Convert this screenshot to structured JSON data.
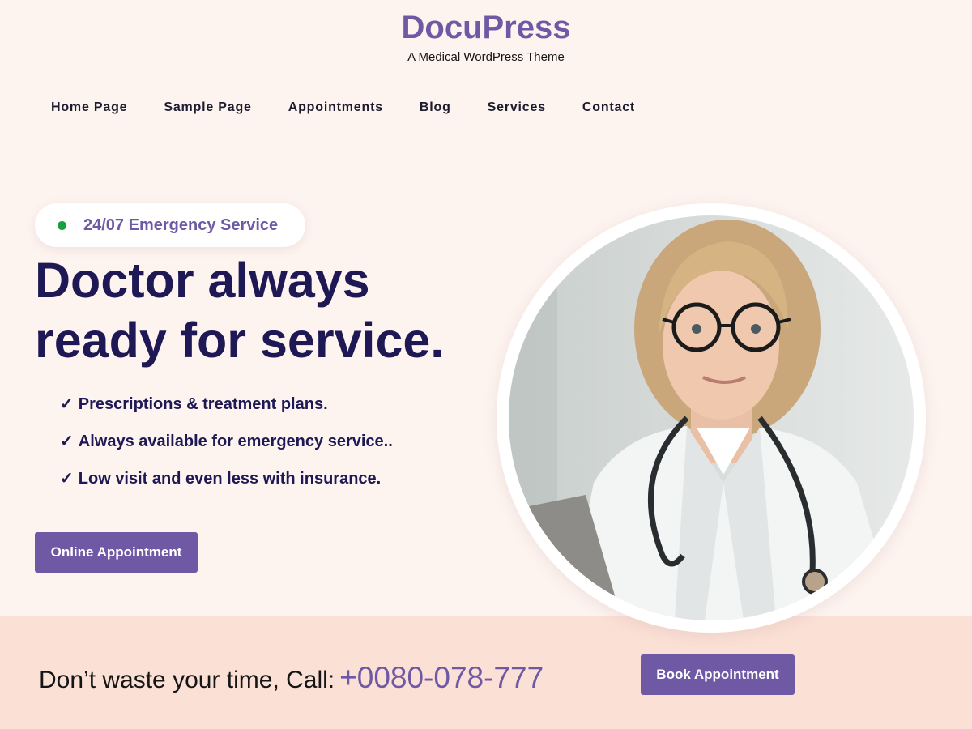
{
  "header": {
    "site_title": "DocuPress",
    "tagline": "A Medical WordPress Theme"
  },
  "nav": {
    "items": [
      {
        "label": "Home Page"
      },
      {
        "label": "Sample Page"
      },
      {
        "label": "Appointments"
      },
      {
        "label": "Blog"
      },
      {
        "label": "Services"
      },
      {
        "label": "Contact"
      }
    ]
  },
  "hero": {
    "badge": {
      "text": "24/07 Emergency Service",
      "dot_color": "#14a23c"
    },
    "headline_line1": "Doctor always",
    "headline_line2": "ready for service.",
    "features": [
      {
        "check": "✓",
        "text": "Prescriptions & treatment plans."
      },
      {
        "check": "✓",
        "text": "Always available for emergency service.."
      },
      {
        "check": "✓",
        "text": "Low visit and even less with insurance."
      }
    ],
    "cta_label": "Online Appointment",
    "image_subject": "doctor-photo"
  },
  "callout": {
    "text": "Don’t waste your time, Call:",
    "phone": "+0080-078-777",
    "button_label": "Book Appointment"
  },
  "colors": {
    "accent": "#6f58a4",
    "heading": "#1e1855",
    "background": "#fdf3ef",
    "band": "#fbe0d6",
    "status_green": "#14a23c"
  }
}
